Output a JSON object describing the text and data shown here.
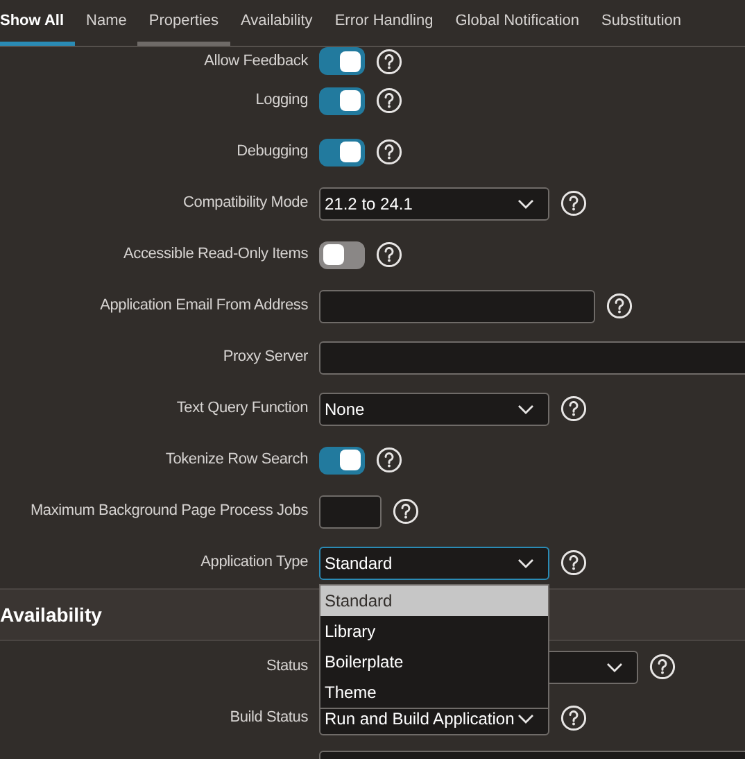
{
  "tabs": [
    {
      "label": "Show All",
      "selected": true,
      "hovered": false
    },
    {
      "label": "Name",
      "selected": false,
      "hovered": false
    },
    {
      "label": "Properties",
      "selected": false,
      "hovered": true
    },
    {
      "label": "Availability",
      "selected": false,
      "hovered": false
    },
    {
      "label": "Error Handling",
      "selected": false,
      "hovered": false
    },
    {
      "label": "Global Notification",
      "selected": false,
      "hovered": false
    },
    {
      "label": "Substitution",
      "selected": false,
      "hovered": false
    }
  ],
  "properties": [
    {
      "kind": "switch",
      "label": "Allow Feedback",
      "on": true
    },
    {
      "kind": "switch",
      "label": "Logging",
      "on": true
    },
    {
      "kind": "switch",
      "label": "Debugging",
      "on": true
    },
    {
      "kind": "select",
      "label": "Compatibility Mode",
      "value": "21.2 to 24.1"
    },
    {
      "kind": "switch",
      "label": "Accessible Read-Only Items",
      "on": false
    },
    {
      "kind": "text",
      "label": "Application Email From Address"
    },
    {
      "kind": "text",
      "label": "Proxy Server"
    },
    {
      "kind": "select",
      "label": "Text Query Function",
      "value": "None"
    },
    {
      "kind": "switch",
      "label": "Tokenize Row Search",
      "on": true
    },
    {
      "kind": "text",
      "label": "Maximum Background Page Process Jobs"
    },
    {
      "kind": "select",
      "label": "Application Type",
      "value": "Standard",
      "focused": true,
      "options": [
        {
          "label": "Standard",
          "selected": true
        },
        {
          "label": "Library",
          "selected": false
        },
        {
          "label": "Boilerplate",
          "selected": false
        },
        {
          "label": "Theme",
          "selected": false
        }
      ]
    }
  ],
  "availability": {
    "title": "Availability",
    "items": [
      {
        "kind": "select",
        "label": "Status"
      },
      {
        "kind": "select",
        "label": "Build Status",
        "value": "Run and Build Application"
      },
      {
        "kind": "text"
      }
    ]
  }
}
